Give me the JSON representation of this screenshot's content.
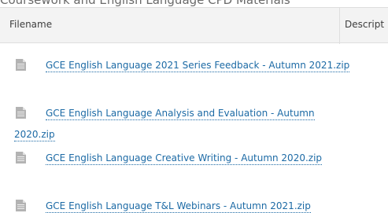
{
  "heading": "Coursework and English Language CPD Materials",
  "table": {
    "headers": {
      "filename": "Filename",
      "description": "Descript"
    },
    "files": [
      {
        "name": "GCE English Language 2021 Series Feedback - Autumn 2021.zip",
        "icon": "file-icon"
      },
      {
        "name_line1": "GCE English Language Analysis and Evaluation - Autumn",
        "name_line2": "2020.zip",
        "icon": "file-icon"
      },
      {
        "name": "GCE English Language Creative Writing - Autumn 2020.zip",
        "icon": "file-icon"
      },
      {
        "name": "GCE English Language T&L Webinars - Autumn 2021.zip",
        "icon": "file-icon"
      }
    ]
  },
  "colors": {
    "link": "#1c6aa5",
    "header_bg": "#f3f3f3",
    "icon": "#a8a8a8"
  }
}
